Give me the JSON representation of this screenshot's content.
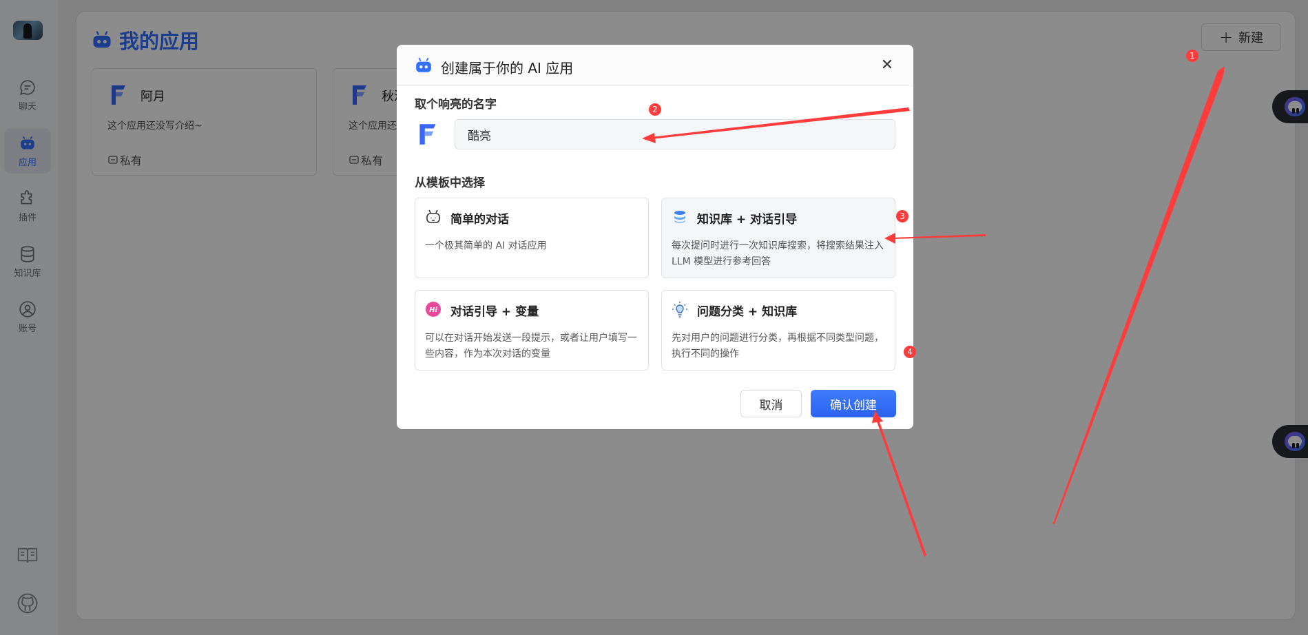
{
  "sidebar": {
    "items": [
      {
        "label": "聊天",
        "icon": "chat-icon"
      },
      {
        "label": "应用",
        "icon": "robot-icon",
        "active": true
      },
      {
        "label": "插件",
        "icon": "puzzle-icon"
      },
      {
        "label": "知识库",
        "icon": "database-icon"
      },
      {
        "label": "账号",
        "icon": "user-icon"
      }
    ],
    "footer_icons": [
      "docs-icon",
      "github-icon"
    ]
  },
  "header": {
    "title": "我的应用",
    "new_button": "新建"
  },
  "apps": [
    {
      "name": "阿月",
      "intro": "这个应用还没写介绍~",
      "visibility": "私有"
    },
    {
      "name": "秋浅",
      "intro": "这个应用还没写介绍~",
      "visibility": "私有"
    }
  ],
  "modal": {
    "title": "创建属于你的 AI 应用",
    "name_label": "取个响亮的名字",
    "name_value": "酷亮",
    "template_label": "从模板中选择",
    "templates": [
      {
        "name": "简单的对话",
        "desc": "一个极其简单的 AI 对话应用",
        "icon": "robot-outline-icon"
      },
      {
        "name": "知识库 + 对话引导",
        "desc": "每次提问时进行一次知识库搜索，将搜索结果注入 LLM 模型进行参考回答",
        "icon": "database-stack-icon",
        "selected": true
      },
      {
        "name": "对话引导 + 变量",
        "desc": "可以在对话开始发送一段提示，或者让用户填写一些内容，作为本次对话的变量",
        "icon": "hi-badge-icon"
      },
      {
        "name": "问题分类 + 知识库",
        "desc": "先对用户的问题进行分类，再根据不同类型问题，执行不同的操作",
        "icon": "lightbulb-icon"
      }
    ],
    "cancel": "取消",
    "confirm": "确认创建"
  },
  "annotations": {
    "badges": [
      "1",
      "2",
      "3",
      "4"
    ],
    "color": "#ff3b3b"
  },
  "colors": {
    "accent": "#3370ff",
    "primary_button": "#2b63f0"
  }
}
